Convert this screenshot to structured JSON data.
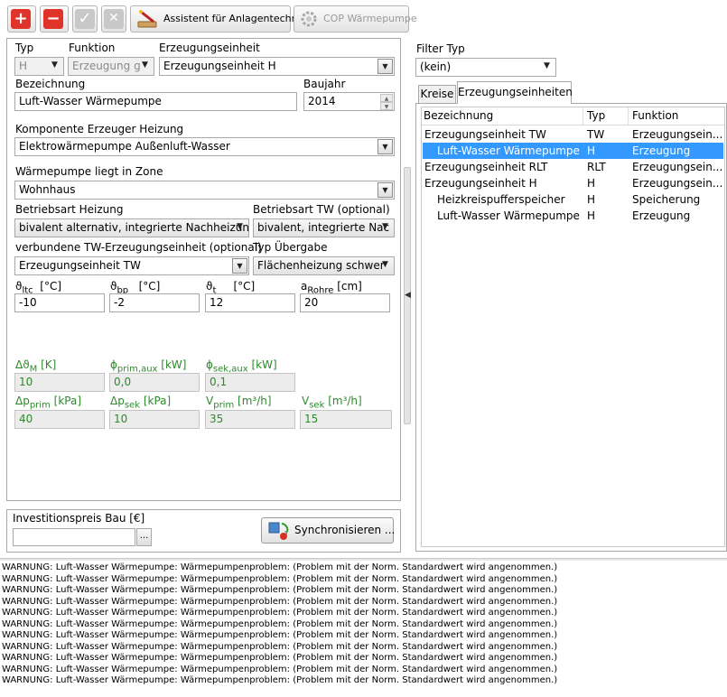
{
  "toolbar": {
    "add": "+",
    "remove": "−",
    "confirm": "✓",
    "cancel": "✕",
    "assistant_label": "Assistent für Anlagentechnik",
    "cop_label": "COP Wärmepumpe"
  },
  "form": {
    "typ_label": "Typ",
    "typ_value": "H",
    "funktion_label": "Funktion",
    "funktion_value": "Erzeugung g",
    "erzeugungseinheit_label": "Erzeugungseinheit",
    "erzeugungseinheit_value": "Erzeugungseinheit H",
    "bezeichnung_label": "Bezeichnung",
    "bezeichnung_value": "Luft-Wasser Wärmepumpe",
    "baujahr_label": "Baujahr",
    "baujahr_value": "2014",
    "komponente_label": "Komponente Erzeuger Heizung",
    "komponente_value": "Elektrowärmepumpe Außenluft-Wasser",
    "zone_label": "Wärmepumpe liegt in Zone",
    "zone_value": "Wohnhaus",
    "betriebsart_h_label": "Betriebsart Heizung",
    "betriebsart_h_value": "bivalent alternativ, integrierte Nachheizung",
    "betriebsart_tw_label": "Betriebsart TW (optional)",
    "betriebsart_tw_value": "bivalent, integrierte Nac",
    "verbundene_label": "verbundene TW-Erzeugungseinheit (optional)",
    "verbundene_value": "Erzeugungseinheit TW",
    "typ_uebergabe_label": "Typ Übergabe",
    "typ_uebergabe_value": "Flächenheizung schwer",
    "params": [
      {
        "sym": "ϑ",
        "sub": "ltc",
        "unit": "[°C]",
        "value": "-10"
      },
      {
        "sym": "ϑ",
        "sub": "bp",
        "unit": "[°C]",
        "value": "-2"
      },
      {
        "sym": "ϑ",
        "sub": "t",
        "unit": "[°C]",
        "value": "12"
      },
      {
        "sym": "a",
        "sub": "Rohre",
        "unit": "[cm]",
        "value": "20"
      }
    ],
    "results_row1": [
      {
        "sym": "Δϑ",
        "sub": "M",
        "unit": "[K]",
        "value": "10"
      },
      {
        "sym": "ϕ",
        "sub": "prim,aux",
        "unit": "[kW]",
        "value": "0,0"
      },
      {
        "sym": "ϕ",
        "sub": "sek,aux",
        "unit": "[kW]",
        "value": "0,1"
      }
    ],
    "results_row2": [
      {
        "sym": "Δp",
        "sub": "prim",
        "unit": "[kPa]",
        "value": "40"
      },
      {
        "sym": "Δp",
        "sub": "sek",
        "unit": "[kPa]",
        "value": "10"
      },
      {
        "sym": "V",
        "sub": "prim",
        "unit": "[m³/h]",
        "value": "35"
      },
      {
        "sym": "V",
        "sub": "sek",
        "unit": "[m³/h]",
        "value": "15"
      }
    ],
    "invest_label": "Investitionspreis Bau [€]",
    "invest_value": "",
    "invest_btn": "...",
    "sync_label": "Synchronisieren ..."
  },
  "filter": {
    "label": "Filter Typ",
    "value": "(kein)"
  },
  "tabs": [
    "Kreise",
    "Erzeugungseinheiten"
  ],
  "table": {
    "headers": [
      "Bezeichnung",
      "Typ",
      "Funktion"
    ],
    "rows": [
      {
        "name": "Erzeugungseinheit TW",
        "typ": "TW",
        "funktion": "Erzeugungsein...",
        "indent": false,
        "selected": false
      },
      {
        "name": "Luft-Wasser Wärmepumpe",
        "typ": "H",
        "funktion": "Erzeugung",
        "indent": true,
        "selected": true
      },
      {
        "name": "Erzeugungseinheit RLT",
        "typ": "RLT",
        "funktion": "Erzeugungsein...",
        "indent": false,
        "selected": false
      },
      {
        "name": "Erzeugungseinheit H",
        "typ": "H",
        "funktion": "Erzeugungsein...",
        "indent": false,
        "selected": false
      },
      {
        "name": "Heizkreispufferspeicher",
        "typ": "H",
        "funktion": "Speicherung",
        "indent": true,
        "selected": false
      },
      {
        "name": "Luft-Wasser Wärmepumpe",
        "typ": "H",
        "funktion": "Erzeugung",
        "indent": true,
        "selected": false
      }
    ]
  },
  "warnings": [
    "WARNUNG: Luft-Wasser Wärmepumpe: Wärmepumpenproblem: (Problem mit der Norm. Standardwert wird angenommen.)",
    "WARNUNG: Luft-Wasser Wärmepumpe: Wärmepumpenproblem: (Problem mit der Norm. Standardwert wird angenommen.)",
    "WARNUNG: Luft-Wasser Wärmepumpe: Wärmepumpenproblem: (Problem mit der Norm. Standardwert wird angenommen.)",
    "WARNUNG: Luft-Wasser Wärmepumpe: Wärmepumpenproblem: (Problem mit der Norm. Standardwert wird angenommen.)",
    "WARNUNG: Luft-Wasser Wärmepumpe: Wärmepumpenproblem: (Problem mit der Norm. Standardwert wird angenommen.)",
    "WARNUNG: Luft-Wasser Wärmepumpe: Wärmepumpenproblem: (Problem mit der Norm. Standardwert wird angenommen.)",
    "WARNUNG: Luft-Wasser Wärmepumpe: Wärmepumpenproblem: (Problem mit der Norm. Standardwert wird angenommen.)",
    "WARNUNG: Luft-Wasser Wärmepumpe: Wärmepumpenproblem: (Problem mit der Norm. Standardwert wird angenommen.)",
    "WARNUNG: Luft-Wasser Wärmepumpe: Wärmepumpenproblem: (Problem mit der Norm. Standardwert wird angenommen.)",
    "WARNUNG: Luft-Wasser Wärmepumpe: Wärmepumpenproblem: (Problem mit der Norm. Standardwert wird angenommen.)",
    "WARNUNG: Luft-Wasser Wärmepumpe: Wärmepumpenproblem: (Problem mit der Norm. Standardwert wird angenommen.)"
  ],
  "colors": {
    "accent_red": "#e0342a",
    "selection": "#3399ff",
    "result_green": "#2c8a2c"
  }
}
